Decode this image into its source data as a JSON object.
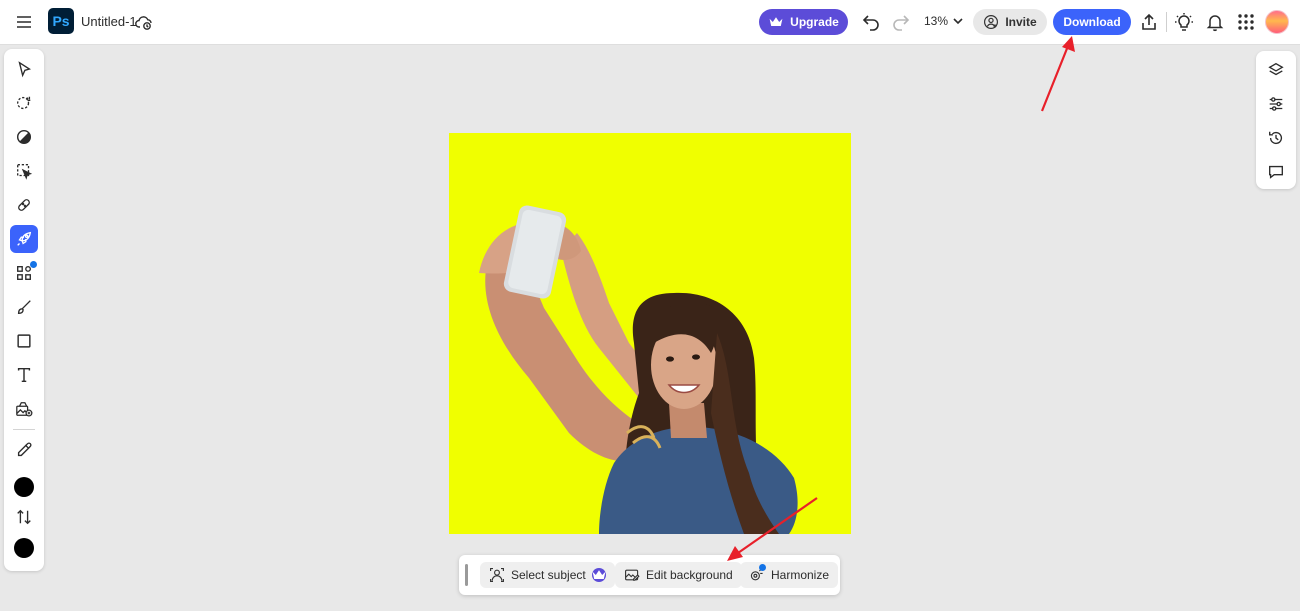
{
  "app": {
    "logo_text": "Ps",
    "document_title": "Untitled-1"
  },
  "header": {
    "menu_icon": "hamburger-menu-icon",
    "cloud_icon": "cloud-sync-icon",
    "upgrade_label": "Upgrade",
    "undo_icon": "undo-icon",
    "redo_icon": "redo-icon",
    "zoom_level": "13%",
    "invite_label": "Invite",
    "download_label": "Download",
    "share_icon": "share-upload-icon",
    "tips_icon": "lightbulb-icon",
    "notifications_icon": "bell-icon",
    "apps_icon": "apps-grid-icon"
  },
  "colors": {
    "accent_blue": "#3b63fb",
    "upgrade_purple": "#5c4cd8",
    "canvas_background": "#f0ff00",
    "annotation_red": "#e8202a",
    "foreground_color": "#000000",
    "background_color": "#000000"
  },
  "left_toolbar": {
    "tools": [
      {
        "name": "move-tool",
        "icon": "cursor-arrow-icon",
        "active": false
      },
      {
        "name": "object-select-tool",
        "icon": "lasso-select-icon",
        "active": false
      },
      {
        "name": "adjust-tool",
        "icon": "half-circle-adjust-icon",
        "active": false
      },
      {
        "name": "selection-tool",
        "icon": "marquee-select-icon",
        "active": false
      },
      {
        "name": "healing-tool",
        "icon": "bandage-icon",
        "active": false
      },
      {
        "name": "quick-actions-tool",
        "icon": "rocket-icon",
        "active": true
      },
      {
        "name": "add-ons-tool",
        "icon": "shapes-grid-icon",
        "active": false
      },
      {
        "name": "brush-tool",
        "icon": "brush-icon",
        "active": false
      },
      {
        "name": "shape-tool",
        "icon": "square-shape-icon",
        "active": false
      },
      {
        "name": "text-tool",
        "icon": "text-icon",
        "active": false
      },
      {
        "name": "place-image-tool",
        "icon": "add-image-icon",
        "active": false
      },
      {
        "name": "eyedropper-tool",
        "icon": "eyedropper-icon",
        "active": false
      }
    ],
    "swap_icon": "swap-colors-icon"
  },
  "right_panel": {
    "items": [
      "layers-icon",
      "adjustments-sliders-icon",
      "history-icon",
      "comments-icon"
    ]
  },
  "contextual_taskbar": {
    "grip_icon": "drag-handle-icon",
    "buttons": [
      {
        "label": "Select subject",
        "icon": "select-subject-icon",
        "badge": "crown-icon"
      },
      {
        "label": "Edit background",
        "icon": "edit-background-icon"
      },
      {
        "label": "Harmonize",
        "icon": "harmonize-icon"
      }
    ]
  }
}
